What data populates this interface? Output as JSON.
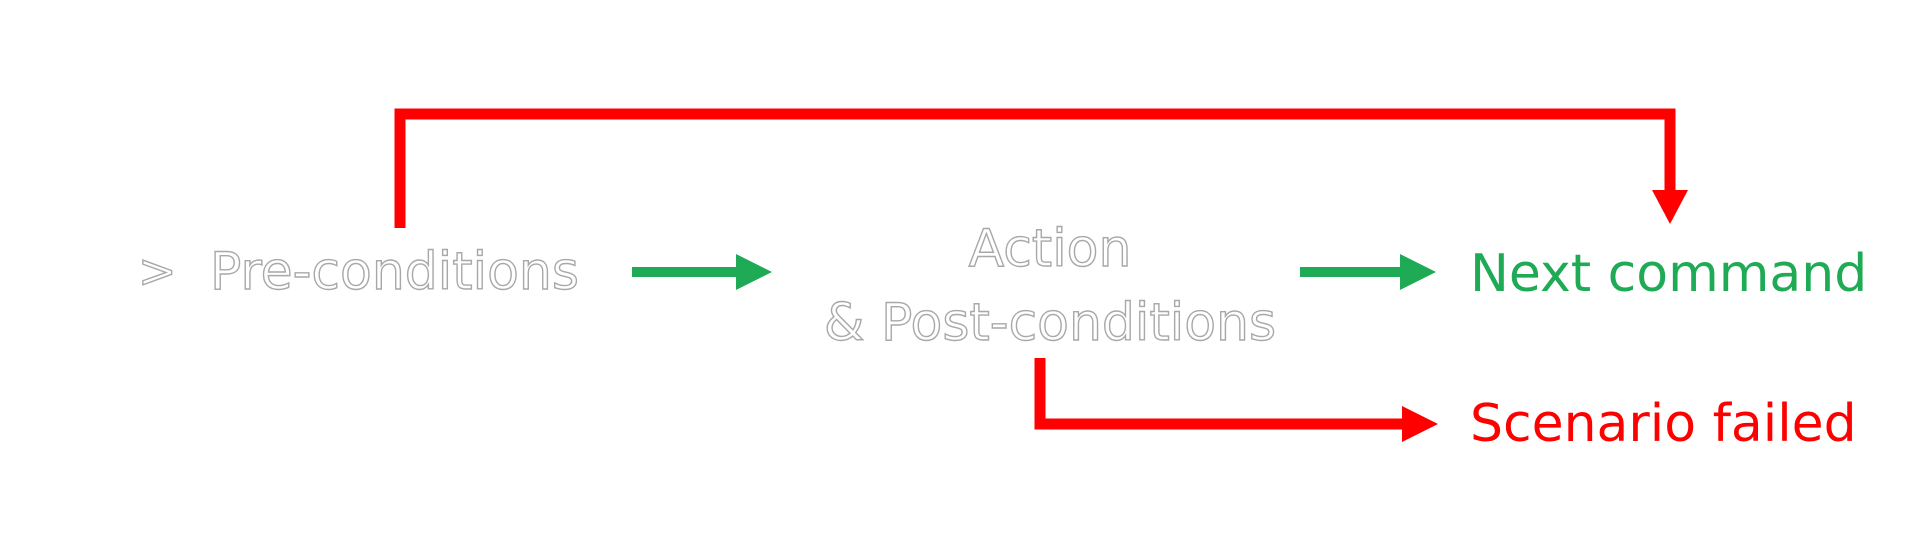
{
  "diagram": {
    "prompt_symbol": ">",
    "pre_conditions": "Pre-conditions",
    "action_line1": "Action",
    "action_line2": "& Post-conditions",
    "next_command": "Next command",
    "scenario_failed": "Scenario failed"
  },
  "colors": {
    "success": "#1faa55",
    "failure": "#ff0000",
    "outline_text": "#a8a8a8"
  }
}
